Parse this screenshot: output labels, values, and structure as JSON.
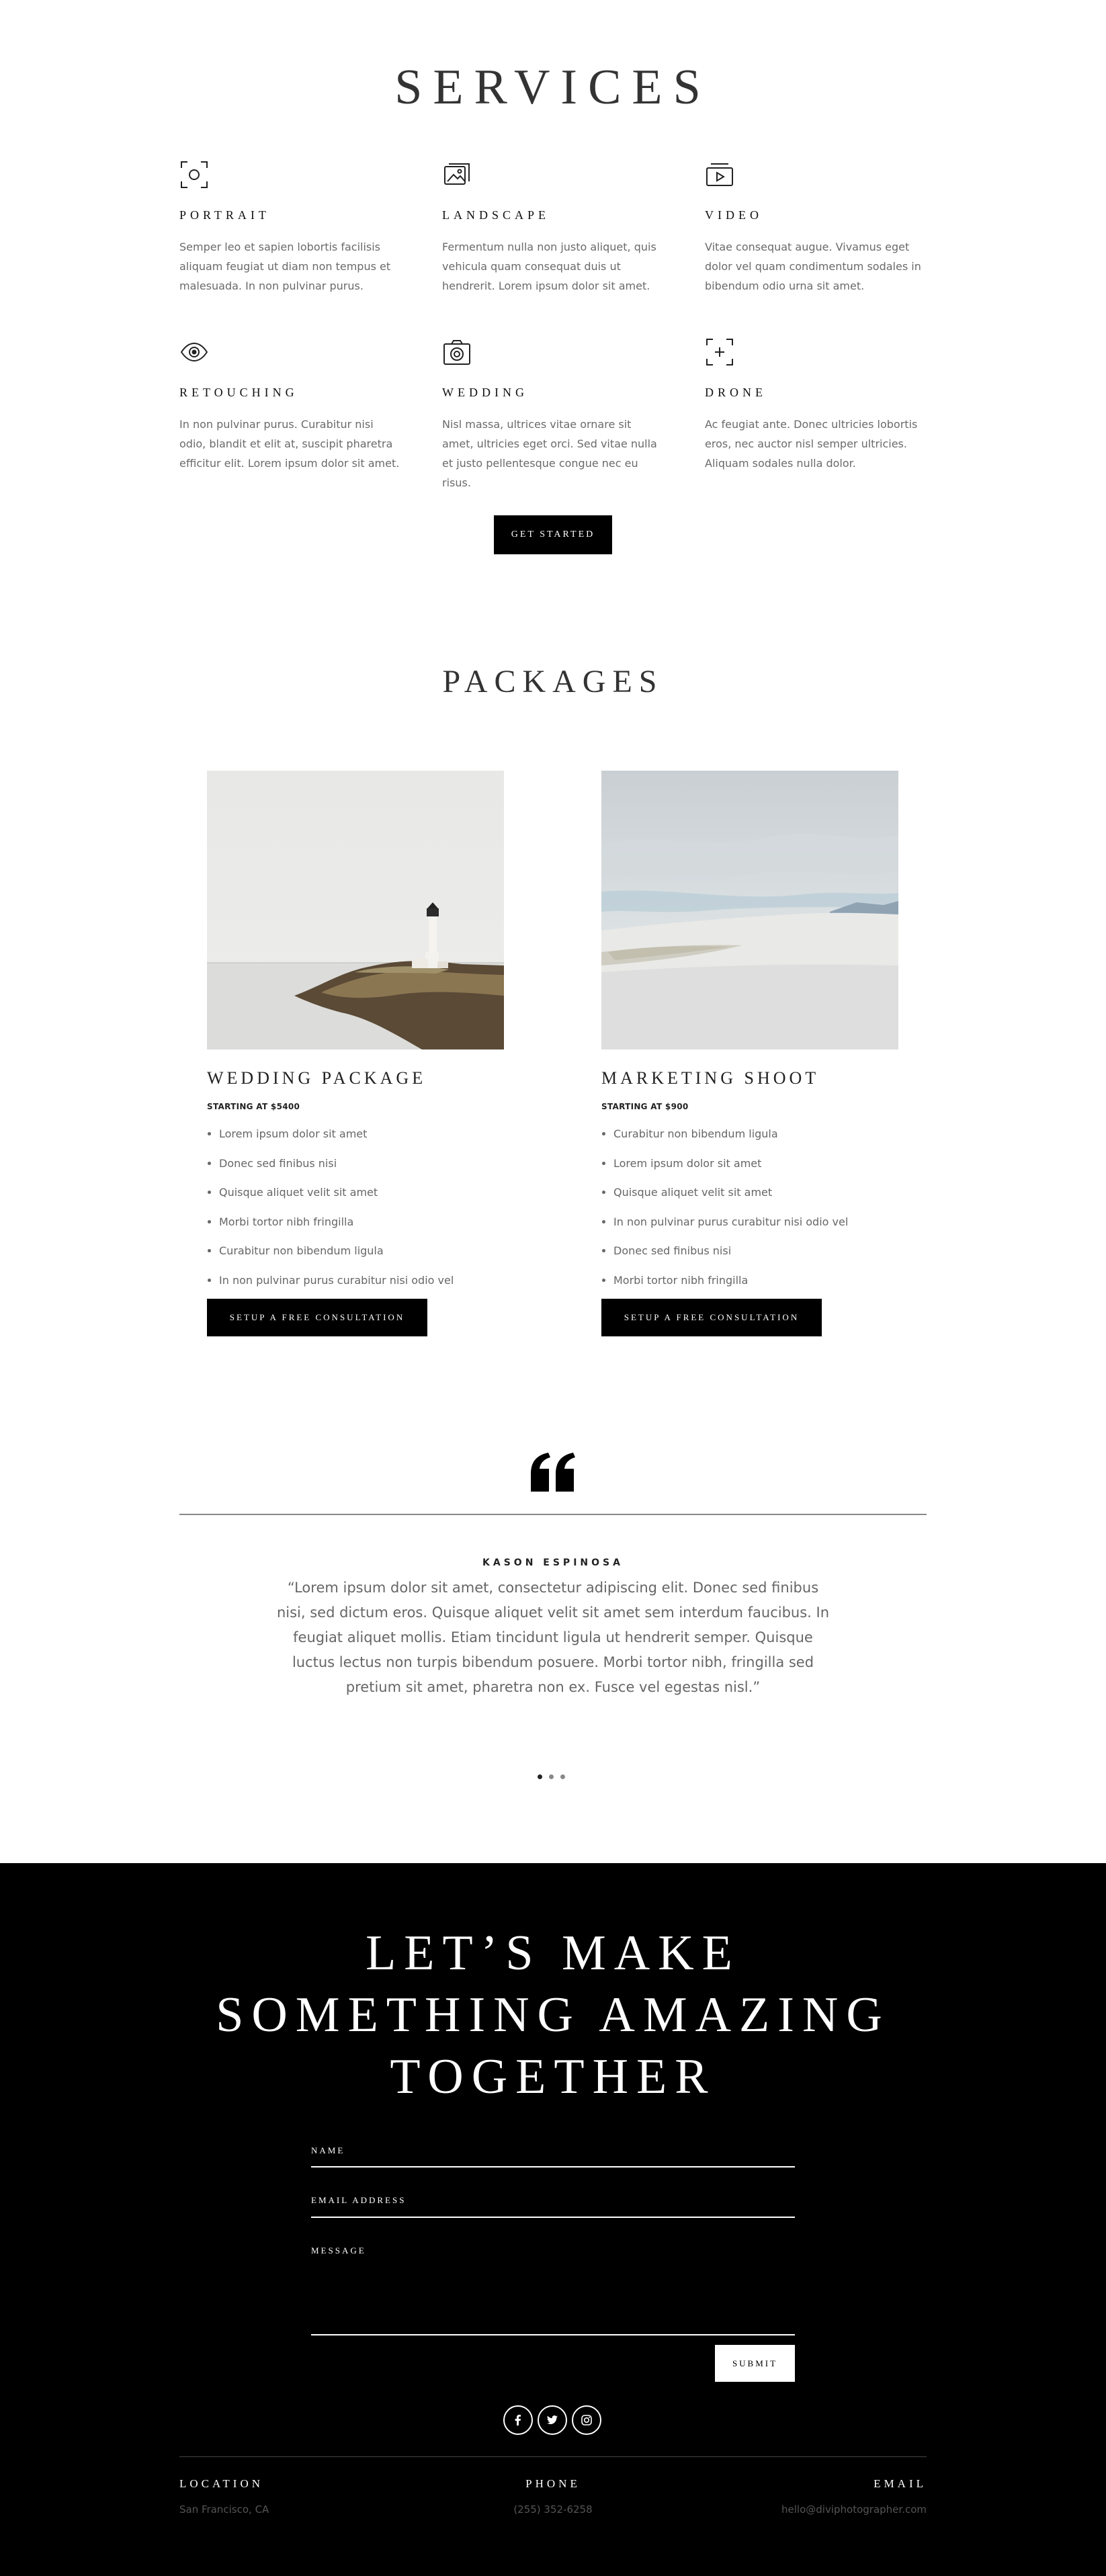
{
  "services": {
    "title": "SERVICES",
    "items": [
      {
        "title": "PORTRAIT",
        "icon": "portrait-focus-icon",
        "text": "Semper leo et sapien lobortis facilisis aliquam feugiat ut diam non tempus et malesuada. In non pulvinar purus."
      },
      {
        "title": "LANDSCAPE",
        "icon": "landscape-photo-icon",
        "text": "Fermentum nulla non justo aliquet, quis vehicula quam consequat duis ut hendrerit. Lorem ipsum dolor sit amet."
      },
      {
        "title": "VIDEO",
        "icon": "video-play-icon",
        "text": "Vitae consequat augue. Vivamus eget dolor vel quam condimentum sodales in bibendum odio urna sit amet."
      },
      {
        "title": "RETOUCHING",
        "icon": "eye-icon",
        "text": "In non pulvinar purus. Curabitur nisi odio, blandit et elit at, suscipit pharetra efficitur elit. Lorem ipsum dolor sit amet."
      },
      {
        "title": "WEDDING",
        "icon": "camera-icon",
        "text": "Nisl massa, ultrices vitae ornare sit amet, ultricies eget orci. Sed vitae nulla et justo pellentesque congue nec eu risus."
      },
      {
        "title": "DRONE",
        "icon": "crosshair-frame-icon",
        "text": "Ac feugiat ante. Donec ultricies lobortis eros, nec auctor nisl semper ultricies. Aliquam sodales nulla dolor."
      }
    ],
    "cta": "GET STARTED"
  },
  "packages": {
    "title": "PACKAGES",
    "items": [
      {
        "name": "WEDDING PACKAGE",
        "price": "STARTING AT $5400",
        "features": [
          "Lorem ipsum dolor sit amet",
          "Donec sed finibus nisi",
          "Quisque aliquet velit sit amet",
          "Morbi tortor nibh fringilla",
          "Curabitur non bibendum ligula",
          "In non pulvinar purus curabitur nisi odio vel"
        ],
        "cta": "SETUP A FREE CONSULTATION"
      },
      {
        "name": "MARKETING SHOOT",
        "price": "STARTING AT $900",
        "features": [
          "Curabitur non bibendum ligula",
          "Lorem ipsum dolor sit amet",
          "Quisque aliquet velit sit amet",
          "In non pulvinar purus curabitur nisi odio vel",
          "Donec sed finibus nisi",
          "Morbi tortor nibh fringilla"
        ],
        "cta": "SETUP A FREE CONSULTATION"
      }
    ]
  },
  "testimonial": {
    "author": "KASON ESPINOSA",
    "quote": "“Lorem ipsum dolor sit amet, consectetur adipiscing elit. Donec sed finibus nisi, sed dictum eros. Quisque aliquet velit sit amet sem interdum faucibus. In feugiat aliquet mollis. Etiam tincidunt ligula ut hendrerit semper. Quisque luctus lectus non turpis bibendum posuere. Morbi tortor nibh, fringilla sed pretium sit amet, pharetra non ex. Fusce vel egestas nisl.”",
    "slides": 3,
    "active_slide": 1
  },
  "contact": {
    "heading_lines": [
      "LET’S MAKE",
      "SOMETHING AMAZING",
      "TOGETHER"
    ],
    "fields": {
      "name": "NAME",
      "email": "EMAIL ADDRESS",
      "message": "MESSAGE"
    },
    "submit": "SUBMIT",
    "social": [
      "facebook-icon",
      "twitter-icon",
      "instagram-icon"
    ]
  },
  "footer": {
    "location": {
      "label": "LOCATION",
      "value": "San Francisco, CA"
    },
    "phone": {
      "label": "PHONE",
      "value": "(255) 352-6258"
    },
    "email": {
      "label": "EMAIL",
      "value": "hello@diviphotographer.com"
    }
  },
  "colors": {
    "accent": "#000000",
    "background": "#ffffff",
    "text": "#666666"
  }
}
